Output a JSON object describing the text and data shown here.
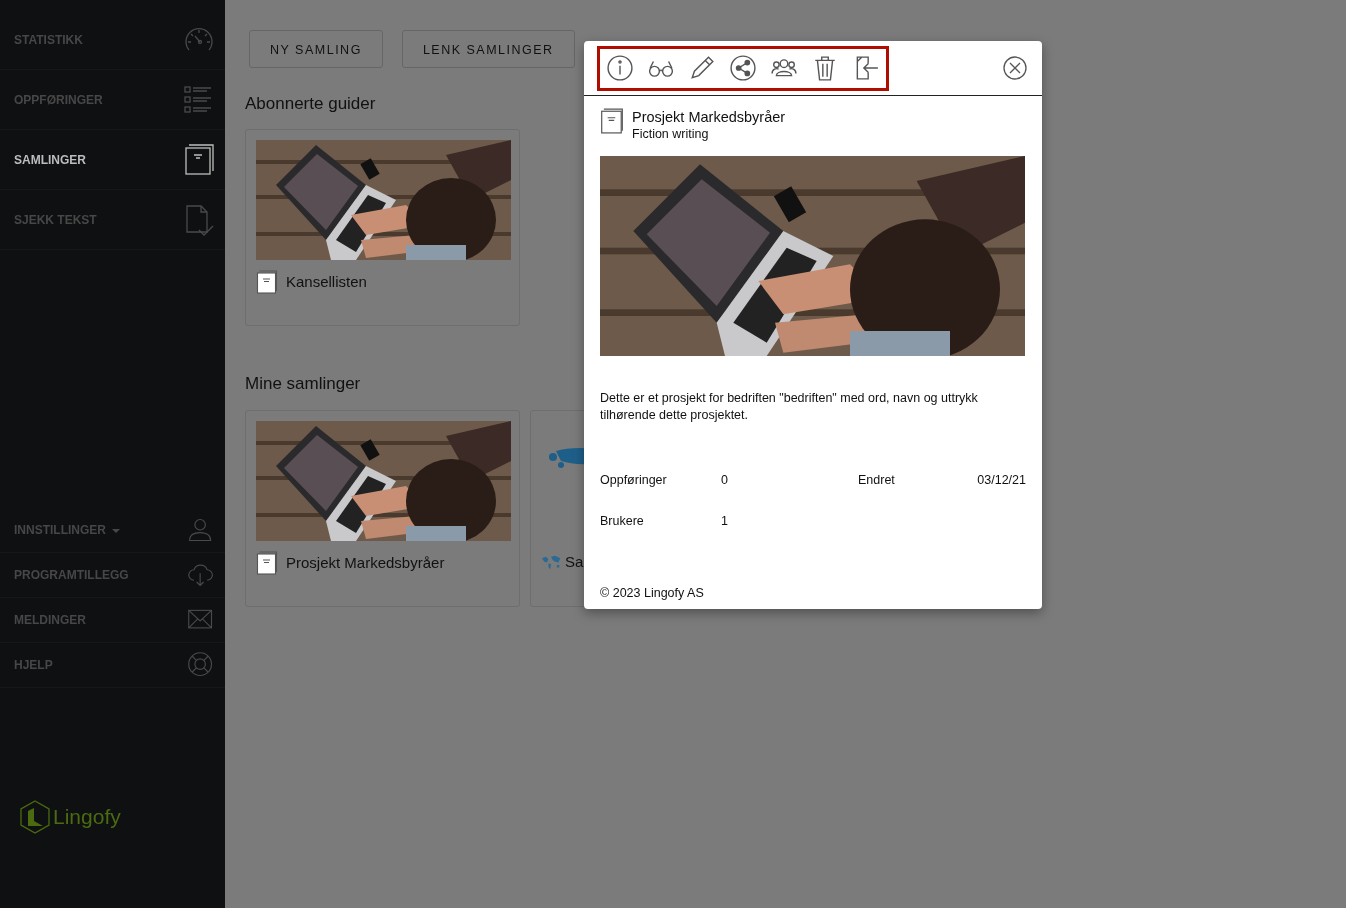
{
  "sidebar": {
    "top_items": [
      {
        "label": "STATISTIKK",
        "selected": false
      },
      {
        "label": "OPPFØRINGER",
        "selected": false
      },
      {
        "label": "SAMLINGER",
        "selected": true
      },
      {
        "label": "SJEKK TEKST",
        "selected": false
      }
    ],
    "bottom_items": [
      {
        "label": "INNSTILLINGER",
        "dropdown": true
      },
      {
        "label": "PROGRAMTILLEGG",
        "dropdown": false
      },
      {
        "label": "MELDINGER",
        "dropdown": false
      },
      {
        "label": "HJELP",
        "dropdown": false
      }
    ],
    "logo": "Lingofy"
  },
  "toolbar_buttons": [
    "NY SAMLING",
    "LENK SAMLINGER"
  ],
  "sections": [
    {
      "title": "Abonnerte guider",
      "cards": [
        {
          "title": "Kansellisten",
          "kind": "book"
        }
      ]
    },
    {
      "title": "Mine samlinger",
      "cards": [
        {
          "title": "Prosjekt Markedsbyråer",
          "kind": "book"
        },
        {
          "title": "Sa",
          "kind": "map"
        }
      ]
    }
  ],
  "modal": {
    "title": "Prosjekt Markedsbyråer",
    "subtitle": "Fiction writing",
    "description": "Dette er et prosjekt for bedriften \"bedriften\" med ord, navn og uttrykk tilhørende dette prosjektet.",
    "stats": [
      [
        {
          "label": "Oppføringer",
          "value": "0"
        },
        {
          "label": "Endret",
          "value": "03/12/21"
        }
      ],
      [
        {
          "label": "Brukere",
          "value": "1"
        }
      ]
    ],
    "footer": "© 2023 Lingofy AS"
  }
}
